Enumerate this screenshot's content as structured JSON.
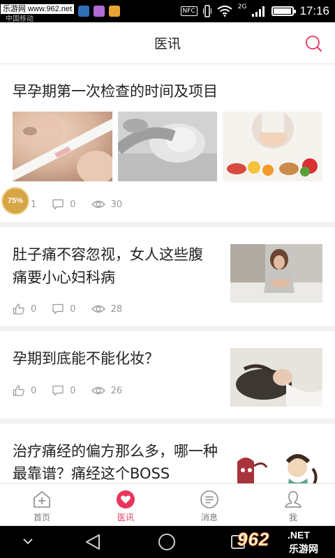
{
  "status_bar": {
    "watermark": "乐游网 www.962.net",
    "carrier": "中国移动",
    "nfc": "NFC",
    "network": "2G",
    "time": "17:16"
  },
  "header": {
    "title": "医讯",
    "search_icon": "search-icon"
  },
  "articles": [
    {
      "title": "早孕期第一次检查的时间及项目",
      "likes": "1",
      "comments": "0",
      "views": "30"
    },
    {
      "title": "肚子痛不容忽视，女人这些腹痛要小心妇科病",
      "likes": "0",
      "comments": "0",
      "views": "28"
    },
    {
      "title": "孕期到底能不能化妆？",
      "likes": "0",
      "comments": "0",
      "views": "26"
    },
    {
      "title": "治疗痛经的偏方那么多，哪一种最靠谱？痛经这个BOSS"
    }
  ],
  "float_badge": "75%",
  "tabs": [
    {
      "label": "首页",
      "icon": "home-plus-icon"
    },
    {
      "label": "医讯",
      "icon": "heart-icon",
      "active": true
    },
    {
      "label": "消息",
      "icon": "message-icon"
    },
    {
      "label": "我",
      "icon": "user-icon"
    }
  ],
  "watermark_logo": {
    "number": "962",
    "suffix": ".NET",
    "name": "乐游网"
  },
  "colors": {
    "accent": "#e8365d",
    "icon_gray": "#9a9a9a"
  }
}
